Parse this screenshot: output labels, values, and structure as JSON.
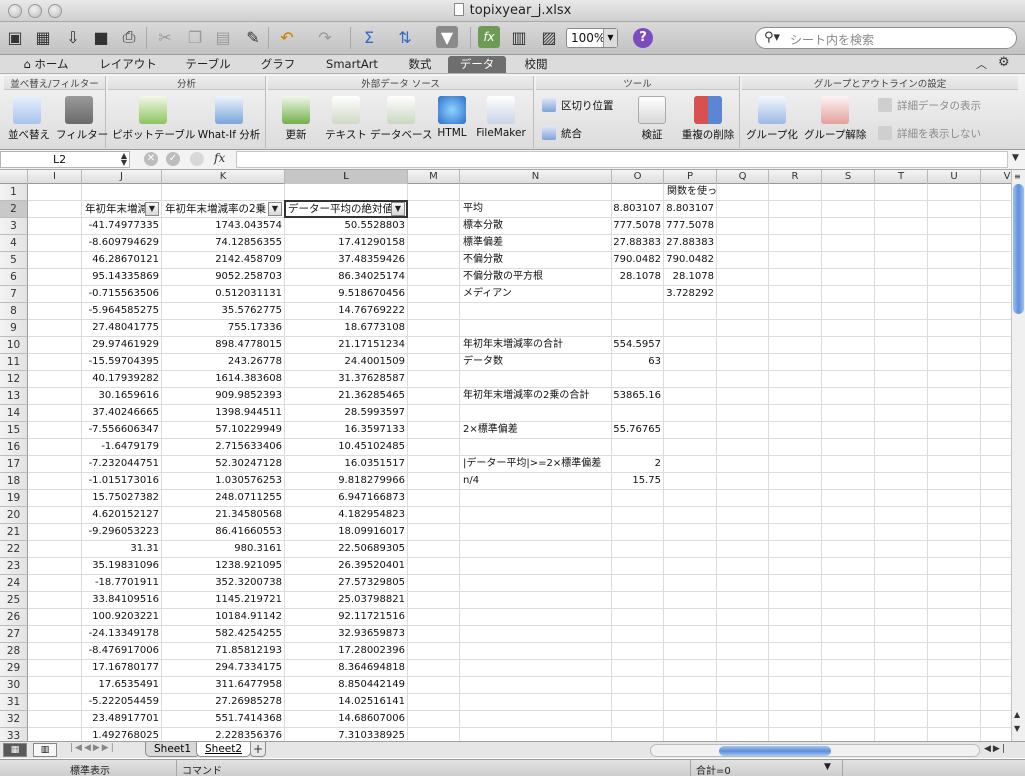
{
  "window": {
    "title": "topixyear_j.xlsx"
  },
  "toolbar": {
    "zoom": "100%",
    "search_placeholder": "シート内を検索",
    "help": "?"
  },
  "ribbon_tabs": [
    "ホーム",
    "レイアウト",
    "テーブル",
    "グラフ",
    "SmartArt",
    "数式",
    "データ",
    "校閲"
  ],
  "active_tab": "データ",
  "ribbon": {
    "groups": {
      "sort_filter": "並べ替え/フィルター",
      "analysis": "分析",
      "external": "外部データ ソース",
      "tools": "ツール",
      "group_outline": "グループとアウトラインの設定"
    },
    "buttons": {
      "sort": "並べ替え",
      "filter": "フィルター",
      "pivot": "ピボットテーブル",
      "whatif": "What-If 分析",
      "refresh": "更新",
      "text": "テキスト",
      "database": "データベース",
      "html": "HTML",
      "filemaker": "FileMaker",
      "delimit": "区切り位置",
      "consolidate": "統合",
      "validate": "検証",
      "dedupe": "重複の削除",
      "group": "グループ化",
      "ungroup": "グループ解除",
      "show_detail": "詳細データの表示",
      "hide_detail": "詳細を表示しない"
    }
  },
  "formula_bar": {
    "name_box": "L2",
    "fx": "fx",
    "content": ""
  },
  "columns": [
    "I",
    "J",
    "K",
    "L",
    "M",
    "N",
    "O",
    "P",
    "Q",
    "R",
    "S",
    "T",
    "U",
    "V"
  ],
  "selected_column": "L",
  "rows": [
    "1",
    "2",
    "3",
    "4",
    "5",
    "6",
    "7",
    "8",
    "9",
    "10",
    "11",
    "12",
    "13",
    "14",
    "15",
    "16",
    "17",
    "18",
    "19",
    "20",
    "21",
    "22",
    "23",
    "24",
    "25",
    "26",
    "27",
    "28",
    "29",
    "30",
    "31",
    "32",
    "33"
  ],
  "selected_row": "2",
  "headers": {
    "J": "年初年末増減率",
    "K": "年初年末増減率の2乗",
    "L": "データー平均の絶対値"
  },
  "col_J": [
    "-41.74977335",
    "-8.609794629",
    "46.28670121",
    "95.14335869",
    "-0.715563506",
    "-5.964585275",
    "27.48041775",
    "29.97461929",
    "-15.59704395",
    "40.17939282",
    "30.1659616",
    "37.40246665",
    "-7.556606347",
    "-1.6479179",
    "-7.232044751",
    "-1.015173016",
    "15.75027382",
    "4.620152127",
    "-9.296053223",
    "31.31",
    "35.19831096",
    "-18.7701911",
    "33.84109516",
    "100.9203221",
    "-24.13349178",
    "-8.476917006",
    "17.16780177",
    "17.6535491",
    "-5.222054459",
    "23.48917701",
    "1.492768025"
  ],
  "col_K": [
    "1743.043574",
    "74.12856355",
    "2142.458709",
    "9052.258703",
    "0.512031131",
    "35.5762775",
    "755.17336",
    "898.4778015",
    "243.26778",
    "1614.383608",
    "909.9852393",
    "1398.944511",
    "57.10229949",
    "2.715633406",
    "52.30247128",
    "1.030576253",
    "248.0711255",
    "21.34580568",
    "86.41660553",
    "980.3161",
    "1238.921095",
    "352.3200738",
    "1145.219721",
    "10184.91142",
    "582.4254255",
    "71.85812193",
    "294.7334175",
    "311.6477958",
    "27.26985278",
    "551.7414368",
    "2.228356376"
  ],
  "col_L": [
    "50.5528803",
    "17.41290158",
    "37.48359426",
    "86.34025174",
    "9.518670456",
    "14.76769222",
    "18.6773108",
    "21.17151234",
    "24.4001509",
    "31.37628587",
    "21.36285465",
    "28.5993597",
    "16.3597133",
    "10.45102485",
    "16.0351517",
    "9.818279966",
    "6.947166873",
    "4.182954823",
    "18.09916017",
    "22.50689305",
    "26.39520401",
    "27.57329805",
    "25.03798821",
    "92.11721516",
    "32.93659873",
    "17.28002396",
    "8.364694818",
    "8.850442149",
    "14.02516141",
    "14.68607006",
    "7.310338925"
  ],
  "stats": {
    "p_header": "関数を使った場合",
    "rows": [
      {
        "row": 2,
        "label": "平均",
        "o": "8.803107",
        "p": "8.803107"
      },
      {
        "row": 3,
        "label": "標本分散",
        "o": "777.5078",
        "p": "777.5078"
      },
      {
        "row": 4,
        "label": "標準偏差",
        "o": "27.88383",
        "p": "27.88383"
      },
      {
        "row": 5,
        "label": "不偏分散",
        "o": "790.0482",
        "p": "790.0482"
      },
      {
        "row": 6,
        "label": "不偏分散の平方根",
        "o": "28.1078",
        "p": "28.1078"
      },
      {
        "row": 7,
        "label": "メディアン",
        "o": "",
        "p": "3.728292"
      },
      {
        "row": 10,
        "label": "年初年末増減率の合計",
        "o": "554.5957",
        "p": ""
      },
      {
        "row": 11,
        "label": "データ数",
        "o": "63",
        "p": ""
      },
      {
        "row": 13,
        "label": "年初年末増減率の2乗の合計",
        "o": "53865.16",
        "p": ""
      },
      {
        "row": 15,
        "label": "2×標準偏差",
        "o": "55.76765",
        "p": ""
      },
      {
        "row": 17,
        "label": "|データー平均|>=2×標準偏差",
        "o": "2",
        "p": ""
      },
      {
        "row": 18,
        "label": "n/4",
        "o": "15.75",
        "p": ""
      }
    ]
  },
  "sheets": [
    "Sheet1",
    "Sheet2"
  ],
  "active_sheet": "Sheet2",
  "status": {
    "view": "標準表示",
    "mode": "コマンド",
    "sum": "合計=0"
  }
}
